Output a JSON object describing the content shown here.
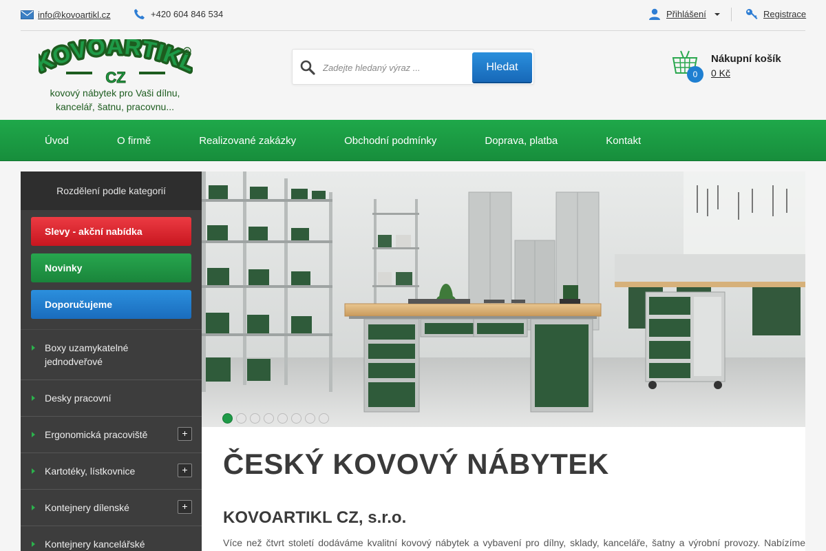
{
  "topbar": {
    "email": "info@kovoartikl.cz",
    "phone": "+420 604 846 534",
    "login_label": "Přihlášení",
    "register_label": "Registrace"
  },
  "header": {
    "logo_text": "KOVOARTIKL",
    "logo_sub": "CZ",
    "tagline": "kovový nábytek pro Vaši dílnu, kancelář, šatnu, pracovnu...",
    "search_placeholder": "Zadejte hledaný výraz ...",
    "search_button": "Hledat",
    "cart_title": "Nákupní košík",
    "cart_count": "0",
    "cart_price": "0 Kč"
  },
  "nav": {
    "items": [
      "Úvod",
      "O firmě",
      "Realizované zakázky",
      "Obchodní podmínky",
      "Doprava, platba",
      "Kontakt"
    ]
  },
  "sidebar": {
    "heading": "Rozdělení podle kategorií",
    "promo": [
      "Slevy - akční nabídka",
      "Novinky",
      "Doporučujeme"
    ],
    "categories": [
      {
        "label": "Boxy uzamykatelné jednodveřové",
        "expandable": false
      },
      {
        "label": "Desky pracovní",
        "expandable": false
      },
      {
        "label": "Ergonomická pracoviště",
        "expandable": true
      },
      {
        "label": "Kartotéky, lístkovnice",
        "expandable": true
      },
      {
        "label": "Kontejnery dílenské",
        "expandable": true
      },
      {
        "label": "Kontejnery kancelářské",
        "expandable": false
      }
    ],
    "plus_symbol": "+"
  },
  "slider": {
    "slide_count": 8,
    "active_index": 0
  },
  "main": {
    "title": "ČESKÝ KOVOVÝ NÁBYTEK",
    "subtitle": "KOVOARTIKL CZ, s.r.o.",
    "intro": "Více než čtvrt století dodáváme kvalitní kovový nábytek a vybavení pro dílny, sklady, kanceláře, šatny a výrobní provozy. Nabízíme"
  },
  "colors": {
    "brand_green": "#1fa84a",
    "logo_green": "#1d5c1f",
    "button_blue": "#1f7fd1",
    "promo_red": "#d9232b",
    "sidebar_dark": "#3d3d3d"
  }
}
